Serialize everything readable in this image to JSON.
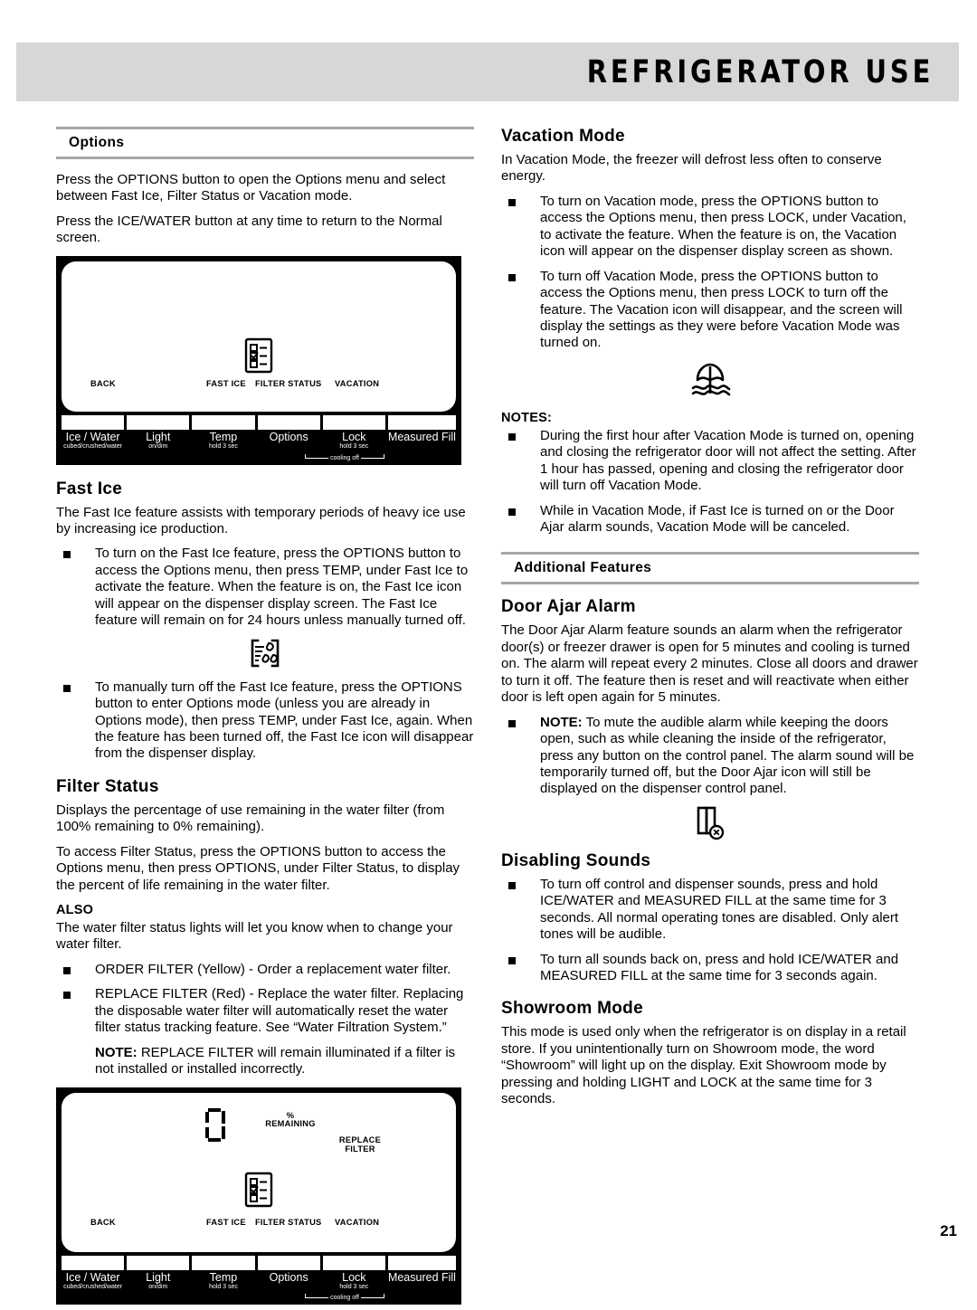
{
  "header": {
    "title": "REFRIGERATOR USE"
  },
  "page_number": "21",
  "left_column": {
    "options_section": {
      "heading": "Options",
      "paragraph_1": "Press the OPTIONS button to open the Options menu and select between Fast Ice, Filter Status or Vacation mode.",
      "paragraph_2": "Press the ICE/WATER button at any time to return to the Normal screen."
    },
    "fast_ice": {
      "heading": "Fast Ice",
      "intro": "The Fast Ice feature assists with temporary periods of heavy ice use by increasing ice production.",
      "bullets": [
        "To turn on the Fast Ice feature, press the OPTIONS button to access the Options menu, then press TEMP, under Fast Ice to activate the feature. When the feature is on, the Fast Ice icon will appear on the dispenser display screen. The Fast Ice feature will remain on for 24 hours unless manually turned off.",
        "To manually turn off the Fast Ice feature, press the OPTIONS button to enter Options mode (unless you are already in Options mode), then press TEMP, under Fast Ice, again. When the feature has been turned off, the Fast Ice icon will disappear from the dispenser display."
      ]
    },
    "filter_status": {
      "heading": "Filter Status",
      "paragraph_1": "Displays the percentage of use remaining in the water filter (from 100% remaining to 0% remaining).",
      "paragraph_2": "To access Filter Status, press the OPTIONS button to access the Options menu, then press OPTIONS, under Filter Status, to display the percent of life remaining in the water filter.",
      "also_heading": "ALSO",
      "also_paragraph": "The water filter status lights will let you know when to change your water filter.",
      "bullets": [
        "ORDER FILTER (Yellow) - Order a replacement water filter.",
        "REPLACE FILTER (Red) - Replace the water filter. Replacing the disposable water filter will automatically reset the water filter status tracking feature. See “Water Filtration System.”"
      ],
      "note_label": "NOTE:",
      "note_text": " REPLACE FILTER will remain illuminated if a filter is not installed or installed incorrectly."
    }
  },
  "right_column": {
    "vacation_mode": {
      "heading": "Vacation Mode",
      "intro": "In Vacation Mode, the freezer will defrost less often to conserve energy.",
      "bullets": [
        "To turn on Vacation mode, press the OPTIONS button to access the Options menu, then press LOCK, under Vacation, to activate the feature. When the feature is on, the Vacation icon will appear on the dispenser display screen as shown.",
        "To turn off Vacation Mode, press the OPTIONS button to access the Options menu, then press LOCK to turn off the feature. The Vacation icon will disappear, and the screen will display the settings as they were before Vacation Mode was turned on."
      ],
      "notes_heading": "NOTES:",
      "notes": [
        "During the first hour after Vacation Mode is turned on, opening and closing the refrigerator door will not affect the setting. After 1 hour has passed, opening and closing the refrigerator door will turn off Vacation Mode.",
        "While in Vacation Mode, if Fast Ice is turned on or the Door Ajar alarm sounds, Vacation Mode will be canceled."
      ]
    },
    "additional_features": {
      "heading": "Additional Features"
    },
    "door_ajar": {
      "heading": "Door Ajar Alarm",
      "paragraph": "The Door Ajar Alarm feature sounds an alarm when the refrigerator door(s) or freezer drawer is open for 5 minutes and cooling is turned on. The alarm will repeat every 2 minutes. Close all doors and drawer to turn it off. The feature then is reset and will reactivate when either door is left open again for 5 minutes.",
      "note_label": "NOTE:",
      "note_text": " To mute the audible alarm while keeping the doors open, such as while cleaning the inside of the refrigerator, press any button on the control panel. The alarm sound will be temporarily turned off, but the Door Ajar icon will still be displayed on the dispenser control panel."
    },
    "disabling_sounds": {
      "heading": "Disabling Sounds",
      "bullets": [
        "To turn off control and dispenser sounds, press and hold ICE/WATER and MEASURED FILL at the same time for 3 seconds. All normal operating tones are disabled. Only alert tones will be audible.",
        "To turn all sounds back on, press and hold ICE/WATER and MEASURED FILL at the same time for 3 seconds again."
      ]
    },
    "showroom_mode": {
      "heading": "Showroom Mode",
      "paragraph": "This mode is used only when the refrigerator is on display in a retail store. If you unintentionally turn on Showroom mode, the word “Showroom” will light up on the display. Exit Showroom mode by pressing and holding LIGHT and LOCK at the same time for 3 seconds."
    }
  },
  "control_panel": {
    "screen_labels": {
      "back": "BACK",
      "fast_ice": "FAST ICE",
      "filter_status": "FILTER STATUS",
      "vacation": "VACATION",
      "percent": "%",
      "remaining": "REMAINING",
      "replace": "REPLACE",
      "filter": "FILTER"
    },
    "buttons": [
      {
        "label": "Ice / Water",
        "sub": "cubed/crushed/water"
      },
      {
        "label": "Light",
        "sub": "on/dim"
      },
      {
        "label": "Temp",
        "sub": "hold 3 sec"
      },
      {
        "label": "Options",
        "sub": ""
      },
      {
        "label": "Lock",
        "sub": "hold 3 sec"
      },
      {
        "label": "Measured Fill",
        "sub": ""
      }
    ],
    "cooling_off_label": "cooling off"
  },
  "icons": {
    "options_list": "checklist-icon",
    "fast_ice": "fast-ice-icon",
    "vacation": "beach-umbrella-icon",
    "door_ajar": "door-ajar-icon"
  }
}
